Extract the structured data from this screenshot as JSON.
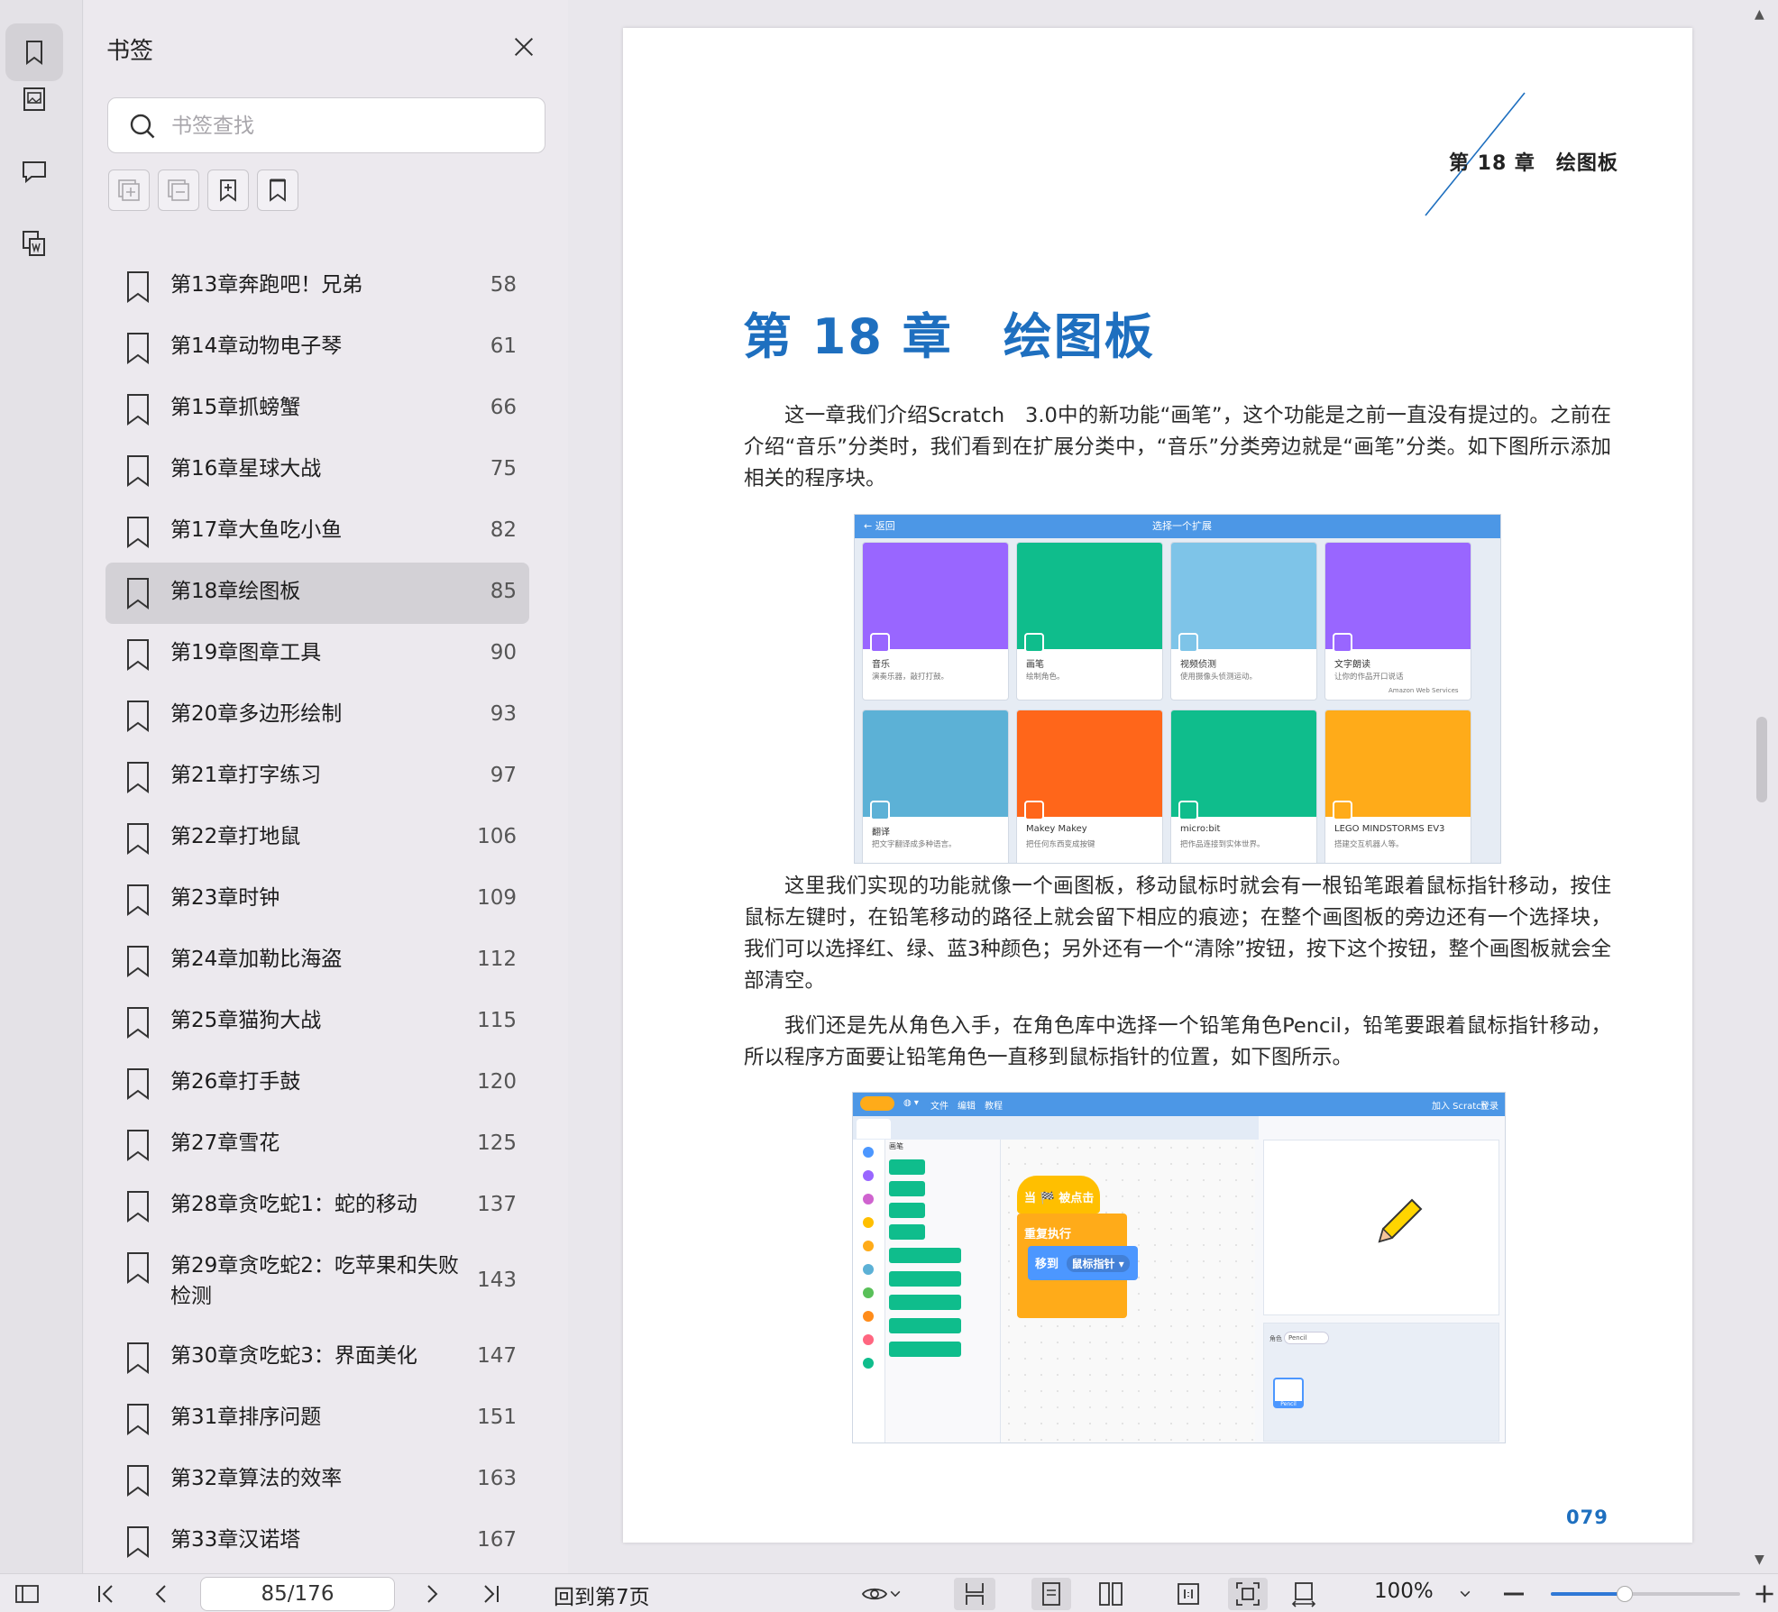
{
  "panel": {
    "title": "书签",
    "search_placeholder": "书签查找"
  },
  "bookmarks": [
    {
      "label": "第13章奔跑吧！兄弟",
      "page": "58"
    },
    {
      "label": "第14章动物电子琴",
      "page": "61"
    },
    {
      "label": "第15章抓螃蟹",
      "page": "66"
    },
    {
      "label": "第16章星球大战",
      "page": "75"
    },
    {
      "label": "第17章大鱼吃小鱼",
      "page": "82"
    },
    {
      "label": "第18章绘图板",
      "page": "85"
    },
    {
      "label": "第19章图章工具",
      "page": "90"
    },
    {
      "label": "第20章多边形绘制",
      "page": "93"
    },
    {
      "label": "第21章打字练习",
      "page": "97"
    },
    {
      "label": "第22章打地鼠",
      "page": "106"
    },
    {
      "label": "第23章时钟",
      "page": "109"
    },
    {
      "label": "第24章加勒比海盗",
      "page": "112"
    },
    {
      "label": "第25章猫狗大战",
      "page": "115"
    },
    {
      "label": "第26章打手鼓",
      "page": "120"
    },
    {
      "label": "第27章雪花",
      "page": "125"
    },
    {
      "label": "第28章贪吃蛇1：蛇的移动",
      "page": "137"
    },
    {
      "label": "第29章贪吃蛇2：吃苹果和失败检测",
      "page": "143"
    },
    {
      "label": "第30章贪吃蛇3：界面美化",
      "page": "147"
    },
    {
      "label": "第31章排序问题",
      "page": "151"
    },
    {
      "label": "第32章算法的效率",
      "page": "163"
    },
    {
      "label": "第33章汉诺塔",
      "page": "167"
    }
  ],
  "active_bookmark": "第18章绘图板",
  "document": {
    "running_head": "第 18 章　绘图板",
    "chapter_title": "第 18 章　绘图板",
    "para1": "这一章我们介绍Scratch　3.0中的新功能“画笔”，这个功能是之前一直没有提过的。之前在介绍“音乐”分类时，我们看到在扩展分类中，“音乐”分类旁边就是“画笔”分类。如下图所示添加相关的程序块。",
    "para2": "这里我们实现的功能就像一个画图板，移动鼠标时就会有一根铅笔跟着鼠标指针移动，按住鼠标左键时，在铅笔移动的路径上就会留下相应的痕迹；在整个画图板的旁边还有一个选择块，我们可以选择红、绿、蓝3种颜色；另外还有一个“清除”按钮，按下这个按钮，整个画图板就会全部清空。",
    "para3": "我们还是先从角色入手，在角色库中选择一个铅笔角色Pencil，铅笔要跟着鼠标指针移动，所以程序方面要让铅笔角色一直移到鼠标指针的位置，如下图所示。",
    "page_number": "079",
    "fig1": {
      "back": "← 返回",
      "title": "选择一个扩展",
      "cards": [
        {
          "name": "音乐",
          "desc": "演奏乐器，敲打打鼓。",
          "color": "#9966ff"
        },
        {
          "name": "画笔",
          "desc": "绘制角色。",
          "color": "#0fbd8c"
        },
        {
          "name": "视频侦测",
          "desc": "使用摄像头侦测运动。",
          "color": "#7ec4e8"
        },
        {
          "name": "文字朗读",
          "desc": "让你的作品开口说话",
          "color": "#9966ff"
        },
        {
          "name": "翻译",
          "desc": "把文字翻译成多种语言。",
          "color": "#5cb1d6"
        },
        {
          "name": "Makey Makey",
          "desc": "把任何东西变成按键",
          "color": "#ff661a"
        },
        {
          "name": "micro:bit",
          "desc": "把作品连接到实体世界。",
          "color": "#0fbd8c"
        },
        {
          "name": "LEGO MINDSTORMS EV3",
          "desc": "搭建交互机器人等。",
          "color": "#ffab19"
        }
      ],
      "card4_extra": "Amazon Web Services"
    },
    "fig2": {
      "menu": [
        "文件",
        "编辑",
        "教程"
      ],
      "menu_right": "加入 Scratch",
      "menu_right2": "登录",
      "category": "画笔",
      "hat_block": "当 🏁 被点击",
      "forever_block": "重复执行",
      "move_block": "移到",
      "move_target": "鼠标指针 ▾",
      "sprite_label": "角色",
      "sprite_value": "Pencil",
      "sprite_thumb": "Pencil"
    }
  },
  "toolbar": {
    "page_field": "85/176",
    "back_to": "回到第7页",
    "zoom": "100%",
    "zoom_fraction": 0.39
  }
}
